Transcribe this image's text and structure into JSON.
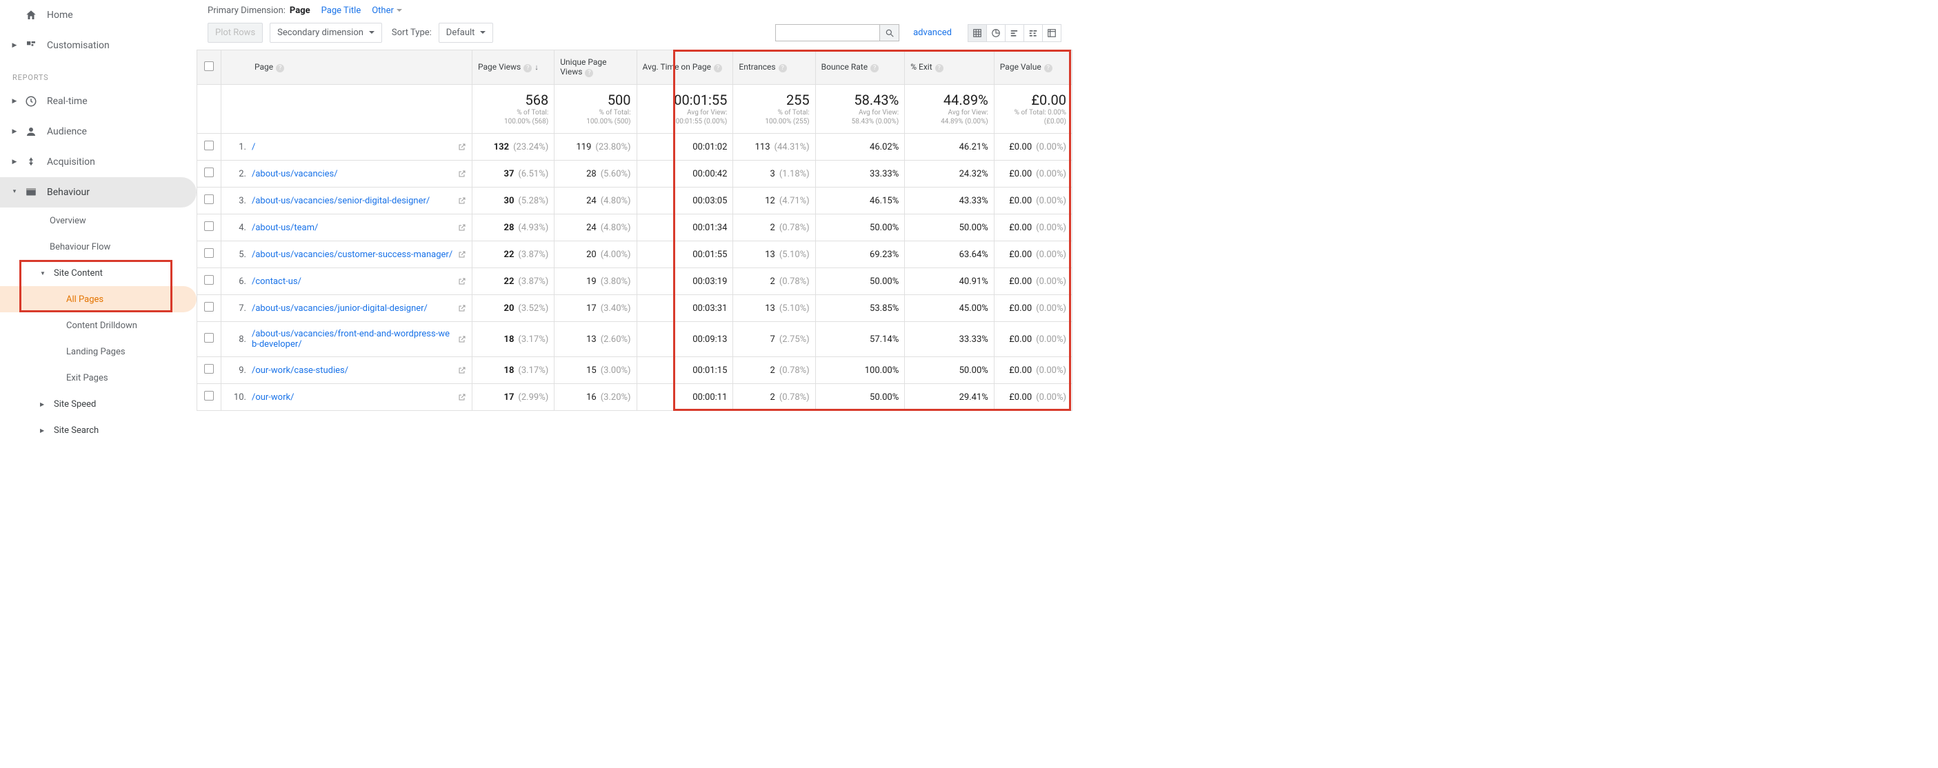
{
  "sidebar": {
    "home": "Home",
    "customisation": "Customisation",
    "reports_header": "REPORTS",
    "items": [
      {
        "label": "Real-time"
      },
      {
        "label": "Audience"
      },
      {
        "label": "Acquisition"
      },
      {
        "label": "Behaviour"
      }
    ],
    "behaviour_sub": {
      "overview": "Overview",
      "flow": "Behaviour Flow",
      "site_content": "Site Content",
      "all_pages": "All Pages",
      "content_drilldown": "Content Drilldown",
      "landing_pages": "Landing Pages",
      "exit_pages": "Exit Pages",
      "site_speed": "Site Speed",
      "site_search": "Site Search"
    }
  },
  "topbar": {
    "primary_dimension_label": "Primary Dimension:",
    "dim_page": "Page",
    "dim_page_title": "Page Title",
    "dim_other": "Other"
  },
  "controls": {
    "plot_rows": "Plot Rows",
    "secondary_dimension": "Secondary dimension",
    "sort_type_label": "Sort Type:",
    "default": "Default",
    "advanced": "advanced"
  },
  "columns": {
    "page": "Page",
    "page_views": "Page Views",
    "unique": "Unique Page Views",
    "avg_time": "Avg. Time on Page",
    "entrances": "Entrances",
    "bounce": "Bounce Rate",
    "exit": "% Exit",
    "value": "Page Value"
  },
  "totals": {
    "page_views": {
      "v": "568",
      "s1": "% of Total:",
      "s2": "100.00% (568)"
    },
    "unique": {
      "v": "500",
      "s1": "% of Total:",
      "s2": "100.00% (500)"
    },
    "avg_time": {
      "v": "00:01:55",
      "s1": "Avg for View:",
      "s2": "00:01:55 (0.00%)"
    },
    "entrances": {
      "v": "255",
      "s1": "% of Total:",
      "s2": "100.00% (255)"
    },
    "bounce": {
      "v": "58.43%",
      "s1": "Avg for View:",
      "s2": "58.43% (0.00%)"
    },
    "exit": {
      "v": "44.89%",
      "s1": "Avg for View:",
      "s2": "44.89% (0.00%)"
    },
    "value": {
      "v": "£0.00",
      "s1": "% of Total: 0.00%",
      "s2": "(£0.00)"
    }
  },
  "rows": [
    {
      "idx": "1.",
      "page": "/",
      "pv": "132",
      "pv_p": "(23.24%)",
      "u": "119",
      "u_p": "(23.80%)",
      "t": "00:01:02",
      "e": "113",
      "e_p": "(44.31%)",
      "b": "46.02%",
      "x": "46.21%",
      "v": "£0.00",
      "v_p": "(0.00%)"
    },
    {
      "idx": "2.",
      "page": "/about-us/vacancies/",
      "pv": "37",
      "pv_p": "(6.51%)",
      "u": "28",
      "u_p": "(5.60%)",
      "t": "00:00:42",
      "e": "3",
      "e_p": "(1.18%)",
      "b": "33.33%",
      "x": "24.32%",
      "v": "£0.00",
      "v_p": "(0.00%)"
    },
    {
      "idx": "3.",
      "page": "/about-us/vacancies/senior-digital-designer/",
      "pv": "30",
      "pv_p": "(5.28%)",
      "u": "24",
      "u_p": "(4.80%)",
      "t": "00:03:05",
      "e": "12",
      "e_p": "(4.71%)",
      "b": "46.15%",
      "x": "43.33%",
      "v": "£0.00",
      "v_p": "(0.00%)"
    },
    {
      "idx": "4.",
      "page": "/about-us/team/",
      "pv": "28",
      "pv_p": "(4.93%)",
      "u": "24",
      "u_p": "(4.80%)",
      "t": "00:01:34",
      "e": "2",
      "e_p": "(0.78%)",
      "b": "50.00%",
      "x": "50.00%",
      "v": "£0.00",
      "v_p": "(0.00%)"
    },
    {
      "idx": "5.",
      "page": "/about-us/vacancies/customer-success-manager/",
      "pv": "22",
      "pv_p": "(3.87%)",
      "u": "20",
      "u_p": "(4.00%)",
      "t": "00:01:55",
      "e": "13",
      "e_p": "(5.10%)",
      "b": "69.23%",
      "x": "63.64%",
      "v": "£0.00",
      "v_p": "(0.00%)"
    },
    {
      "idx": "6.",
      "page": "/contact-us/",
      "pv": "22",
      "pv_p": "(3.87%)",
      "u": "19",
      "u_p": "(3.80%)",
      "t": "00:03:19",
      "e": "2",
      "e_p": "(0.78%)",
      "b": "50.00%",
      "x": "40.91%",
      "v": "£0.00",
      "v_p": "(0.00%)"
    },
    {
      "idx": "7.",
      "page": "/about-us/vacancies/junior-digital-designer/",
      "pv": "20",
      "pv_p": "(3.52%)",
      "u": "17",
      "u_p": "(3.40%)",
      "t": "00:03:31",
      "e": "13",
      "e_p": "(5.10%)",
      "b": "53.85%",
      "x": "45.00%",
      "v": "£0.00",
      "v_p": "(0.00%)"
    },
    {
      "idx": "8.",
      "page": "/about-us/vacancies/front-end-and-wordpress-web-developer/",
      "pv": "18",
      "pv_p": "(3.17%)",
      "u": "13",
      "u_p": "(2.60%)",
      "t": "00:09:13",
      "e": "7",
      "e_p": "(2.75%)",
      "b": "57.14%",
      "x": "33.33%",
      "v": "£0.00",
      "v_p": "(0.00%)"
    },
    {
      "idx": "9.",
      "page": "/our-work/case-studies/",
      "pv": "18",
      "pv_p": "(3.17%)",
      "u": "15",
      "u_p": "(3.00%)",
      "t": "00:01:15",
      "e": "2",
      "e_p": "(0.78%)",
      "b": "100.00%",
      "x": "50.00%",
      "v": "£0.00",
      "v_p": "(0.00%)"
    },
    {
      "idx": "10.",
      "page": "/our-work/",
      "pv": "17",
      "pv_p": "(2.99%)",
      "u": "16",
      "u_p": "(3.20%)",
      "t": "00:00:11",
      "e": "2",
      "e_p": "(0.78%)",
      "b": "50.00%",
      "x": "29.41%",
      "v": "£0.00",
      "v_p": "(0.00%)"
    }
  ]
}
